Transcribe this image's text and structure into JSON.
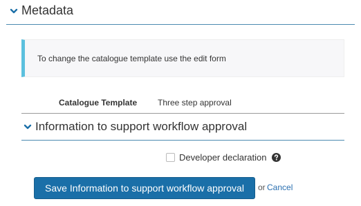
{
  "metadata_section": {
    "title": "Metadata",
    "info_message": "To change the catalogue template use the edit form",
    "catalogue_template_label": "Catalogue Template",
    "catalogue_template_value": "Three step approval"
  },
  "workflow_section": {
    "title": "Information to support workflow approval",
    "developer_declaration_label": "Developer declaration",
    "developer_declaration_checked": false
  },
  "actions": {
    "save_label": "Save Information to support workflow approval",
    "or_text": "or",
    "cancel_label": "Cancel"
  },
  "colors": {
    "accent": "#1a6fa8",
    "info_bar": "#5bc0de",
    "link": "#2a6fb0"
  },
  "icons": {
    "section_toggle": "chevron-down-icon",
    "help": "question-circle-icon"
  }
}
